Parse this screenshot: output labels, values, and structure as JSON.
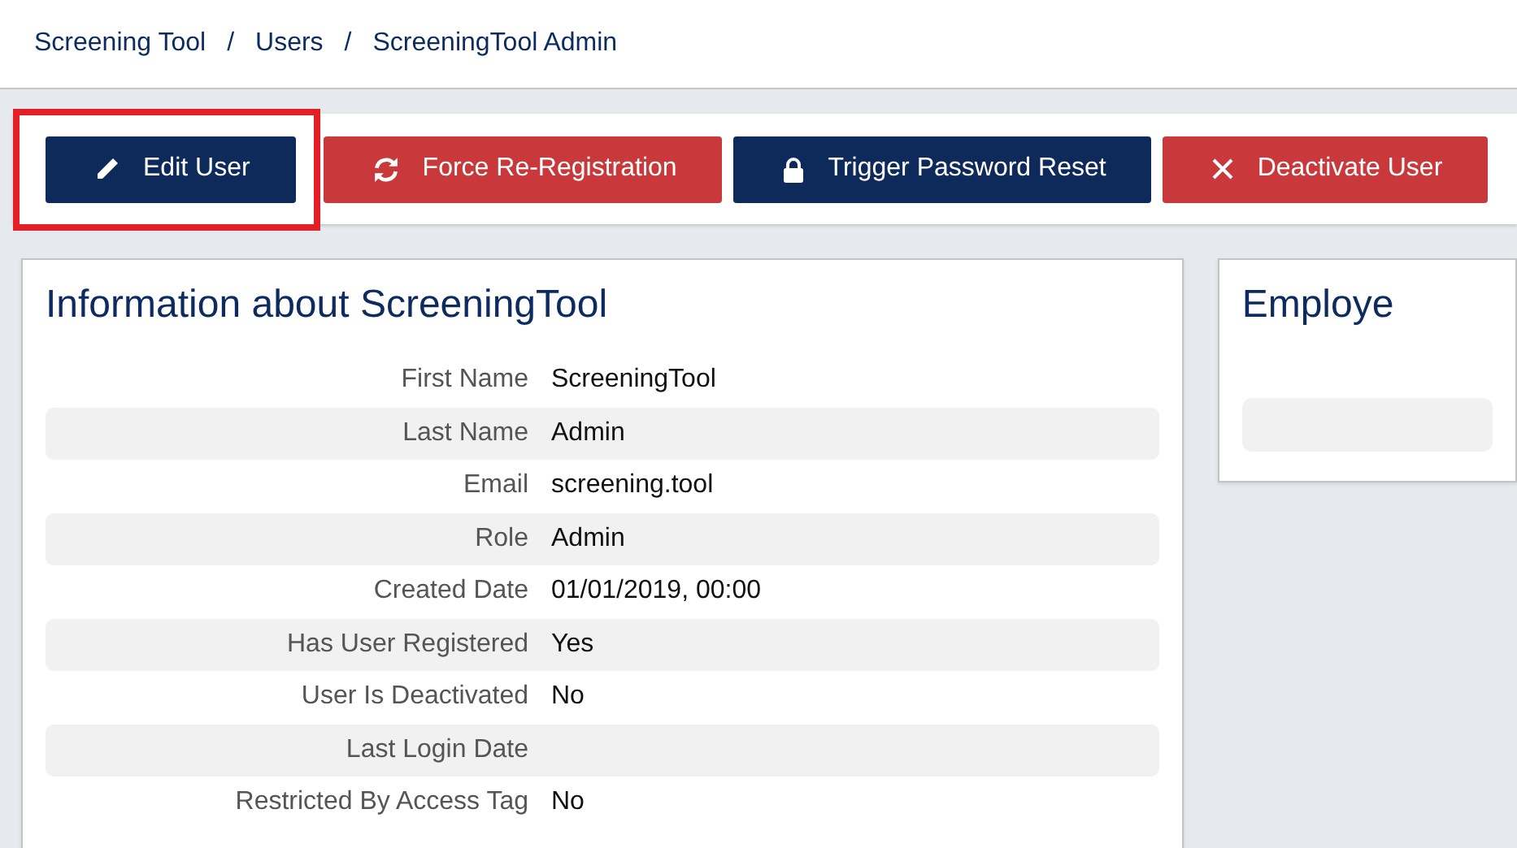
{
  "breadcrumb": [
    {
      "label": "Screening Tool"
    },
    {
      "label": "/",
      "kind": "separator"
    },
    {
      "label": "Users"
    },
    {
      "label": "/",
      "kind": "separator"
    },
    {
      "label": "ScreeningTool Admin"
    }
  ],
  "toolbar": {
    "buttons": [
      {
        "label": "Edit User",
        "kind": "edit",
        "highlighted": true
      },
      {
        "label": "Force Re-Registration",
        "kind": "reregister",
        "highlighted": false
      },
      {
        "label": "Trigger Password Reset",
        "kind": "reset",
        "highlighted": false
      },
      {
        "label": "Deactivate User",
        "kind": "deactivate",
        "highlighted": false
      }
    ]
  },
  "info_card": {
    "title": "Information about ScreeningTool",
    "rows": [
      {
        "label": "First Name",
        "value": "ScreeningTool"
      },
      {
        "label": "Last Name",
        "value": "Admin"
      },
      {
        "label": "Email",
        "value": "screening.tool"
      },
      {
        "label": "Role",
        "value": "Admin"
      },
      {
        "label": "Created Date",
        "value": "01/01/2019, 00:00"
      },
      {
        "label": "Has User Registered",
        "value": "Yes"
      },
      {
        "label": "User Is Deactivated",
        "value": "No"
      },
      {
        "label": "Last Login Date"
      },
      {
        "label": "Restricted By Access Tag",
        "value": "No"
      }
    ]
  },
  "side_card": {
    "title": "Employe"
  }
}
